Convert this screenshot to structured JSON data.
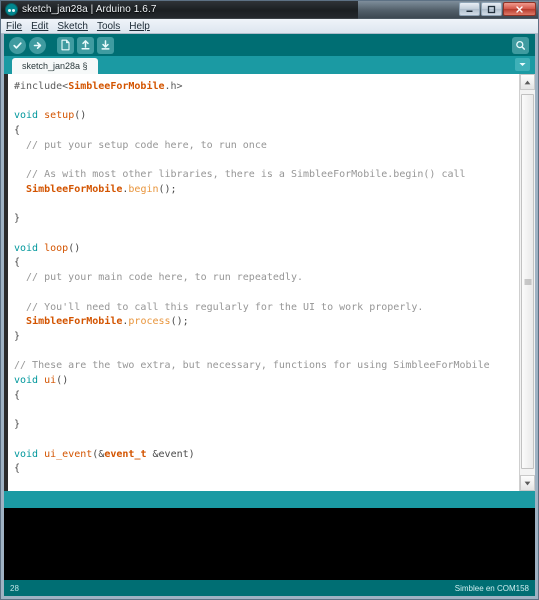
{
  "window": {
    "title": "sketch_jan28a | Arduino 1.6.7",
    "app_icon": "arduino-icon",
    "buttons": {
      "minimize": "—",
      "maximize": "□",
      "close": "✕"
    }
  },
  "menubar": {
    "items": [
      {
        "label": "File"
      },
      {
        "label": "Edit"
      },
      {
        "label": "Sketch"
      },
      {
        "label": "Tools"
      },
      {
        "label": "Help"
      }
    ]
  },
  "toolbar": {
    "buttons": [
      {
        "name": "verify-button",
        "icon": "check-icon",
        "tooltip": "Verify"
      },
      {
        "name": "upload-button",
        "icon": "arrow-right-icon",
        "tooltip": "Upload"
      },
      {
        "name": "new-button",
        "icon": "page-icon",
        "tooltip": "New"
      },
      {
        "name": "open-button",
        "icon": "arrow-up-icon",
        "tooltip": "Open"
      },
      {
        "name": "save-button",
        "icon": "arrow-down-icon",
        "tooltip": "Save"
      }
    ],
    "serial_monitor": {
      "name": "serial-monitor-button",
      "icon": "magnifier-icon",
      "tooltip": "Serial Monitor"
    }
  },
  "tabs": {
    "active": "sketch_jan28a §",
    "menu_icon": "chevron-down-icon"
  },
  "editor": {
    "lines": [
      [
        {
          "t": "#include<",
          "c": "pre"
        },
        {
          "t": "SimbleeForMobile",
          "c": "lib"
        },
        {
          "t": ".h>",
          "c": "pre"
        }
      ],
      [],
      [
        {
          "t": "void",
          "c": "kw"
        },
        {
          "t": " ",
          "c": "punc"
        },
        {
          "t": "setup",
          "c": "fn"
        },
        {
          "t": "()",
          "c": "punc"
        }
      ],
      [
        {
          "t": "{",
          "c": "punc"
        }
      ],
      [
        {
          "t": "  // put your setup code here, to run once",
          "c": "cmt"
        }
      ],
      [],
      [
        {
          "t": "  // As with most other libraries, there is a SimbleeForMobile.begin() call",
          "c": "cmt"
        }
      ],
      [
        {
          "t": "  ",
          "c": "punc"
        },
        {
          "t": "SimbleeForMobile",
          "c": "lib"
        },
        {
          "t": ".",
          "c": "punc"
        },
        {
          "t": "begin",
          "c": "meth"
        },
        {
          "t": "();",
          "c": "punc"
        }
      ],
      [],
      [
        {
          "t": "}",
          "c": "punc"
        }
      ],
      [],
      [
        {
          "t": "void",
          "c": "kw"
        },
        {
          "t": " ",
          "c": "punc"
        },
        {
          "t": "loop",
          "c": "fn"
        },
        {
          "t": "()",
          "c": "punc"
        }
      ],
      [
        {
          "t": "{",
          "c": "punc"
        }
      ],
      [
        {
          "t": "  // put your main code here, to run repeatedly.",
          "c": "cmt"
        }
      ],
      [],
      [
        {
          "t": "  // You'll need to call this regularly for the UI to work properly.",
          "c": "cmt"
        }
      ],
      [
        {
          "t": "  ",
          "c": "punc"
        },
        {
          "t": "SimbleeForMobile",
          "c": "lib"
        },
        {
          "t": ".",
          "c": "punc"
        },
        {
          "t": "process",
          "c": "meth"
        },
        {
          "t": "();",
          "c": "punc"
        }
      ],
      [
        {
          "t": "}",
          "c": "punc"
        }
      ],
      [],
      [
        {
          "t": "// These are the two extra, but necessary, functions for using SimbleeForMobile",
          "c": "cmt"
        }
      ],
      [
        {
          "t": "void",
          "c": "kw"
        },
        {
          "t": " ",
          "c": "punc"
        },
        {
          "t": "ui",
          "c": "fn"
        },
        {
          "t": "()",
          "c": "punc"
        }
      ],
      [
        {
          "t": "{",
          "c": "punc"
        }
      ],
      [],
      [
        {
          "t": "}",
          "c": "punc"
        }
      ],
      [],
      [
        {
          "t": "void",
          "c": "kw"
        },
        {
          "t": " ",
          "c": "punc"
        },
        {
          "t": "ui_event",
          "c": "fn"
        },
        {
          "t": "(&",
          "c": "punc"
        },
        {
          "t": "event_t",
          "c": "typ"
        },
        {
          "t": " &event)",
          "c": "punc"
        }
      ],
      [
        {
          "t": "{",
          "c": "punc"
        }
      ],
      [],
      [
        {
          "t": "}",
          "c": "punc"
        }
      ]
    ],
    "scrollbar": {
      "up_icon": "triangle-up-icon",
      "down_icon": "triangle-down-icon"
    }
  },
  "statusbar": {
    "line_number": "28",
    "board_info": "Simblee en COM158"
  },
  "colors": {
    "toolbar_teal": "#006e73",
    "tab_teal": "#1b9aa3",
    "keyword": "#00979c",
    "library": "#d35400",
    "comment": "#969696",
    "console_bg": "#000000"
  }
}
